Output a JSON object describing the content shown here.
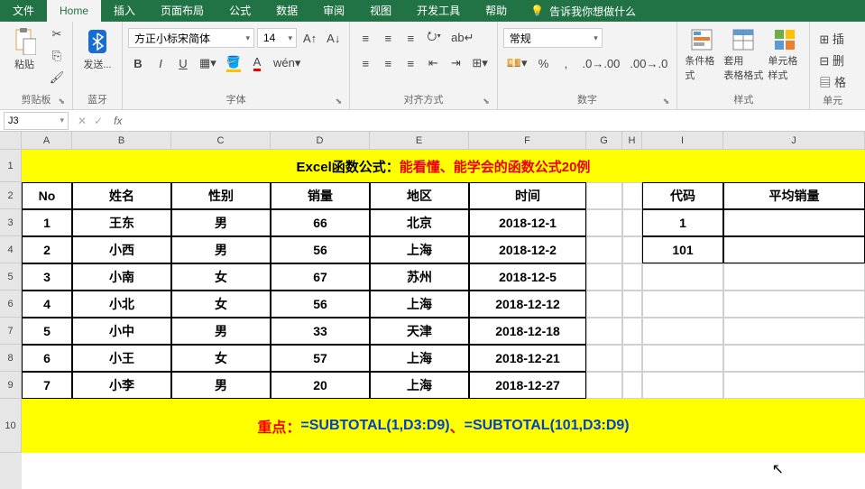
{
  "tabs": [
    "文件",
    "Home",
    "插入",
    "页面布局",
    "公式",
    "数据",
    "审阅",
    "视图",
    "开发工具",
    "帮助"
  ],
  "tell_me": "告诉我你想做什么",
  "ribbon": {
    "paste": "粘贴",
    "clip_group": "剪贴板",
    "bt_send": "发送...",
    "bt_group": "蓝牙",
    "font_name": "方正小标宋简体",
    "font_size": "14",
    "font_group": "字体",
    "align_group": "对齐方式",
    "num_format": "常规",
    "num_group": "数字",
    "cond_fmt": "条件格式",
    "table_fmt": "套用\n表格格式",
    "cell_fmt": "单元格样式",
    "style_group": "样式",
    "cell_group": "单元"
  },
  "name_box": "J3",
  "grid": {
    "cols": [
      "A",
      "B",
      "C",
      "D",
      "E",
      "F",
      "G",
      "H",
      "I",
      "J"
    ],
    "rows": [
      "1",
      "2",
      "3",
      "4",
      "5",
      "6",
      "7",
      "8",
      "9",
      "10"
    ],
    "title_prefix": "Excel函数公式：",
    "title_rest": "能看懂、能学会的函数公式20例",
    "headers": [
      "No",
      "姓名",
      "性别",
      "销量",
      "地区",
      "时间"
    ],
    "side_headers": [
      "代码",
      "平均销量"
    ],
    "data": [
      {
        "no": "1",
        "name": "王东",
        "sex": "男",
        "qty": "66",
        "city": "北京",
        "date": "2018-12-1",
        "code": "1"
      },
      {
        "no": "2",
        "name": "小西",
        "sex": "男",
        "qty": "56",
        "city": "上海",
        "date": "2018-12-2",
        "code": "101"
      },
      {
        "no": "3",
        "name": "小南",
        "sex": "女",
        "qty": "67",
        "city": "苏州",
        "date": "2018-12-5",
        "code": ""
      },
      {
        "no": "4",
        "name": "小北",
        "sex": "女",
        "qty": "56",
        "city": "上海",
        "date": "2018-12-12",
        "code": ""
      },
      {
        "no": "5",
        "name": "小中",
        "sex": "男",
        "qty": "33",
        "city": "天津",
        "date": "2018-12-18",
        "code": ""
      },
      {
        "no": "6",
        "name": "小王",
        "sex": "女",
        "qty": "57",
        "city": "上海",
        "date": "2018-12-21",
        "code": ""
      },
      {
        "no": "7",
        "name": "小李",
        "sex": "男",
        "qty": "20",
        "city": "上海",
        "date": "2018-12-27",
        "code": ""
      }
    ],
    "footer_label": "重点：",
    "footer_f1": "=SUBTOTAL(1,D3:D9)",
    "footer_sep": "、",
    "footer_f2": "=SUBTOTAL(101,D3:D9)"
  }
}
